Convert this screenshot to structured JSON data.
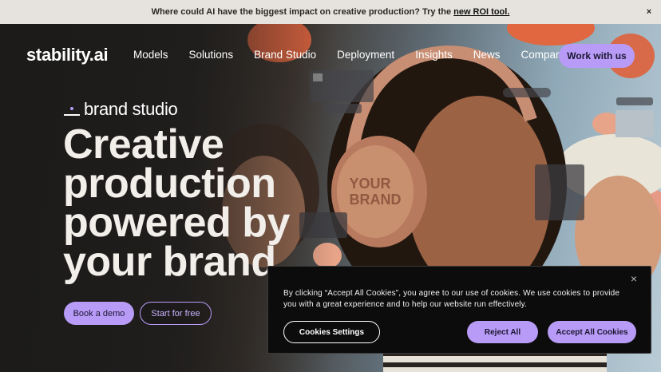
{
  "announcement": {
    "text": "Where could AI have the biggest impact on creative production? Try the",
    "link": "new ROI tool.",
    "close": "×"
  },
  "nav": {
    "logo": "stability.ai",
    "links": [
      "Models",
      "Solutions",
      "Brand Studio",
      "Deployment",
      "Insights",
      "News",
      "Company"
    ],
    "cta": "Work with us"
  },
  "hero": {
    "eyebrow": "brand studio",
    "headline": "Creative production powered by your brand",
    "headphone_text": "YOUR BRAND",
    "primary_button": "Book a demo",
    "secondary_button": "Start for free"
  },
  "cookie_banner": {
    "close": "×",
    "text": "By clicking “Accept All Cookies”, you agree to our use of cookies. We use cookies to provide you with a great experience and to help our website run effectively.",
    "settings_button": "Cookies Settings",
    "reject_button": "Reject All",
    "accept_button": "Accept All Cookies"
  },
  "colors": {
    "accent": "#b79bf7",
    "announcement_bg": "#e6e3de",
    "banner_bg": "#0c0c0c"
  }
}
